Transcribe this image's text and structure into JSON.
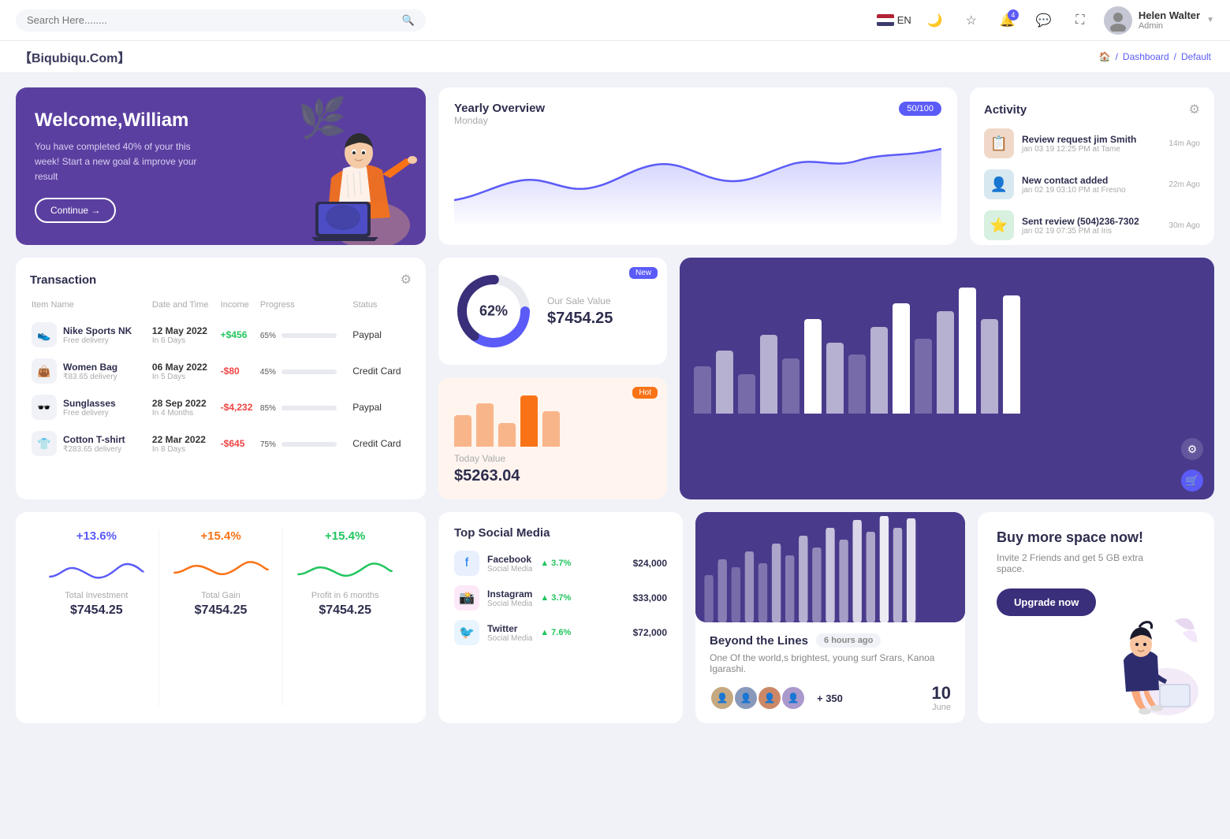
{
  "topnav": {
    "search_placeholder": "Search Here........",
    "lang": "EN",
    "user_name": "Helen Walter",
    "user_role": "Admin",
    "notification_count": "4"
  },
  "breadcrumb": {
    "brand": "【Biqubiqu.Com】",
    "home": "🏠",
    "separator": "/",
    "dashboard": "Dashboard",
    "current": "Default"
  },
  "welcome": {
    "title": "Welcome,William",
    "description": "You have completed 40% of your this week! Start a new goal & improve your result",
    "button": "Continue →"
  },
  "yearly_overview": {
    "title": "Yearly Overview",
    "subtitle": "Monday",
    "badge": "50/100"
  },
  "activity": {
    "title": "Activity",
    "items": [
      {
        "title": "Review request jim Smith",
        "subtitle": "jan 03 19 12:25 PM at Tame",
        "time": "14m Ago",
        "emoji": "📋"
      },
      {
        "title": "New contact added",
        "subtitle": "jan 02 19 03:10 PM at Fresno",
        "time": "22m Ago",
        "emoji": "👤"
      },
      {
        "title": "Sent review (504)236-7302",
        "subtitle": "jan 02 19 07:35 PM at Iris",
        "time": "30m Ago",
        "emoji": "⭐"
      }
    ]
  },
  "transaction": {
    "title": "Transaction",
    "columns": [
      "Item Name",
      "Date and Time",
      "Income",
      "Progress",
      "Status"
    ],
    "rows": [
      {
        "name": "Nike Sports NK",
        "sub": "Free delivery",
        "date": "12 May 2022",
        "date_sub": "In 6 Days",
        "income": "+$456",
        "income_type": "pos",
        "progress": 65,
        "status": "Paypal",
        "color": "#22c55e",
        "emoji": "👟"
      },
      {
        "name": "Women Bag",
        "sub": "₹83.65 delivery",
        "date": "06 May 2022",
        "date_sub": "In 5 Days",
        "income": "-$80",
        "income_type": "neg",
        "progress": 45,
        "status": "Credit Card",
        "color": "#f97316",
        "emoji": "👜"
      },
      {
        "name": "Sunglasses",
        "sub": "Free delivery",
        "date": "28 Sep 2022",
        "date_sub": "In 4 Months",
        "income": "-$4,232",
        "income_type": "neg",
        "progress": 85,
        "status": "Paypal",
        "color": "#ef4444",
        "emoji": "🕶️"
      },
      {
        "name": "Cotton T-shirt",
        "sub": "₹283.65 delivery",
        "date": "22 Mar 2022",
        "date_sub": "In 8 Days",
        "income": "-$645",
        "income_type": "neg",
        "progress": 75,
        "status": "Credit Card",
        "color": "#22c55e",
        "emoji": "👕"
      }
    ]
  },
  "sale_value": {
    "percentage": "62%",
    "label": "Our Sale Value",
    "value": "$7454.25",
    "badge": "New"
  },
  "today_value": {
    "label": "Today Value",
    "value": "$5263.04",
    "badge": "Hot"
  },
  "beyond": {
    "title": "Beyond the Lines",
    "time": "6 hours ago",
    "description": "One Of the world,s brightest, young surf Srars, Kanoa Igarashi.",
    "plus_count": "+ 350",
    "date": "10",
    "date_label": "June"
  },
  "metrics": [
    {
      "percentage": "+13.6%",
      "color": "purple",
      "label": "Total Investment",
      "value": "$7454.25"
    },
    {
      "percentage": "+15.4%",
      "color": "orange",
      "label": "Total Gain",
      "value": "$7454.25"
    },
    {
      "percentage": "+15.4%",
      "color": "green",
      "label": "Profit in 6 months",
      "value": "$7454.25"
    }
  ],
  "social_media": {
    "title": "Top Social Media",
    "items": [
      {
        "name": "Facebook",
        "sub": "Social Media",
        "growth": "3.7%",
        "amount": "$24,000",
        "icon": "fb"
      },
      {
        "name": "Instagram",
        "sub": "Social Media",
        "growth": "3.7%",
        "amount": "$33,000",
        "icon": "ig"
      },
      {
        "name": "Twitter",
        "sub": "Social Media",
        "growth": "7.6%",
        "amount": "$72,000",
        "icon": "tw"
      }
    ]
  },
  "buy_space": {
    "title": "Buy more space now!",
    "description": "Invite 2 Friends and get 5 GB extra space.",
    "button": "Upgrade now"
  }
}
